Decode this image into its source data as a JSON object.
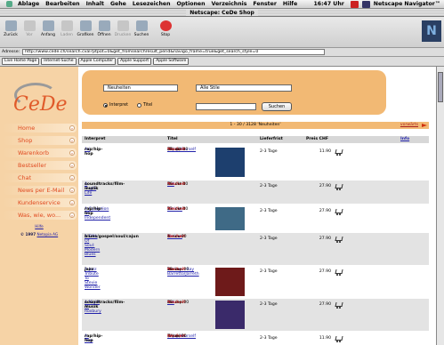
{
  "menubar": {
    "items": [
      "Ablage",
      "Bearbeiten",
      "Inhalt",
      "Gehe",
      "Lesezeichen",
      "Optionen",
      "Verzeichnis",
      "Fenster",
      "Hilfe"
    ],
    "clock": "16:47 Uhr",
    "app": "Netscape Navigator™"
  },
  "window": {
    "title": "Netscape: CeDe Shop"
  },
  "toolbar": {
    "back": "Zurück",
    "forward": "Vor",
    "home": "Anfang",
    "reload": "Laden",
    "images": "Grafiken",
    "open": "Öffnen",
    "print": "Drucken",
    "find": "Suchen",
    "stop": "Stop"
  },
  "address": {
    "label": "Adresse:",
    "url": "http://www.cede.ch/search.cval?ptpot=0&get_fromsearchresult_perid&navigo_frame=true&get_search_style=0"
  },
  "bookmarks": [
    "Live Home Page",
    "Internet-Suche",
    "Apple Computer",
    "Apple Support",
    "Apple Software"
  ],
  "logo_text": "CeDe",
  "nav": [
    "Home",
    "Shop",
    "Warenkorb",
    "Bestseller",
    "Chat",
    "News per E-Mail",
    "Kundenservice",
    "Was, wie, wo..."
  ],
  "sidebar": {
    "link": "Hilfe",
    "copyright": "© 1997",
    "copyright_link": "Netopia AG"
  },
  "search": {
    "category": "Neuheiten",
    "style": "Alle Stile",
    "radio_interpret": "Interpret",
    "radio_title": "Titel",
    "query_value": "",
    "button": "Suchen"
  },
  "results": {
    "count": "1 - 30 / 3128 'Neuheiten'",
    "next": "vorwärts"
  },
  "table": {
    "headers": [
      "Interpret",
      "Titel",
      "Lieferfrist",
      "Preis CHF",
      "Info"
    ],
    "rows": [
      {
        "artist": "Ari",
        "genre": "rap/hip-hop",
        "title": "Enjoy Yourself",
        "format": "(Maxi)",
        "new": "Neuheit",
        "date": "25. okt 00",
        "delivery": "2-3 Tage",
        "price": "11.90",
        "info": "",
        "cover": "#1d3f6e"
      },
      {
        "artist": "A Bug'S Life",
        "genre": "soundtracks/film-musik",
        "title": "Ost",
        "format": "",
        "new": "Neuheit",
        "date": "26. okt 00",
        "delivery": "2-3 Tage",
        "price": "27.90",
        "info": "",
        "cover": ""
      },
      {
        "artist": "A Collection Of Independent",
        "genre": "rap/hip-hop",
        "title": "Various",
        "format": "",
        "new": "Neuheit",
        "date": "23. okt 00",
        "delivery": "2-3 Tage",
        "price": "27.90",
        "info": "",
        "cover": "#3f6a86"
      },
      {
        "artist": "A Fifth Of Soul: Modern Blues",
        "genre": "blues/gospel/soul/cajun",
        "title": "Various",
        "format": "",
        "new": "Neuheit",
        "date": "4. nov 00",
        "delivery": "2-3 Tage",
        "price": "27.90",
        "info": "",
        "cover": ""
      },
      {
        "artist": "A Jazz Tribute To Stevie Wonder",
        "genre": "jazz",
        "title": "Various - Ray Barretto/Jarreth",
        "format": "Lewis",
        "new": "Neuheit",
        "date": "28. sep 00",
        "delivery": "2-3 Tage",
        "price": "27.90",
        "info": "",
        "cover": "#6e1a1a"
      },
      {
        "artist": "A Night At Roxbury",
        "genre": "soundtracks/film-musik",
        "title": "Ost",
        "format": "",
        "new": "Neuheit",
        "date": "28. sep 00",
        "delivery": "2-3 Tage",
        "price": "27.90",
        "info": "",
        "cover": "#3a2a6a"
      },
      {
        "artist": "A-Plus",
        "genre": "rap/hip-hop",
        "title": "Enjoy Yourself",
        "format": "(Maxi)",
        "new": "Neuheit",
        "date": "7. nov 00",
        "delivery": "2-3 Tage",
        "price": "11.90",
        "info": "",
        "cover": ""
      }
    ]
  }
}
